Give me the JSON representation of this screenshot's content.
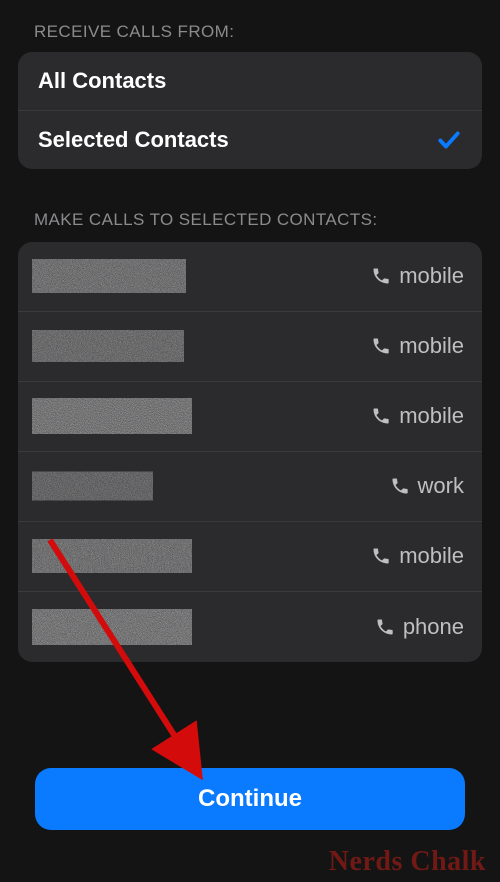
{
  "sections": {
    "receive_header": "RECEIVE CALLS FROM:",
    "make_header": "MAKE CALLS TO SELECTED CONTACTS:"
  },
  "receive_options": [
    {
      "label": "All Contacts",
      "selected": false
    },
    {
      "label": "Selected Contacts",
      "selected": true
    }
  ],
  "contacts": [
    {
      "type_label": "mobile"
    },
    {
      "type_label": "mobile"
    },
    {
      "type_label": "mobile"
    },
    {
      "type_label": "work"
    },
    {
      "type_label": "mobile"
    },
    {
      "type_label": "phone"
    }
  ],
  "continue_label": "Continue",
  "watermark_text": "Nerds Chalk",
  "colors": {
    "accent": "#0a7aff",
    "check": "#0a7aff"
  }
}
